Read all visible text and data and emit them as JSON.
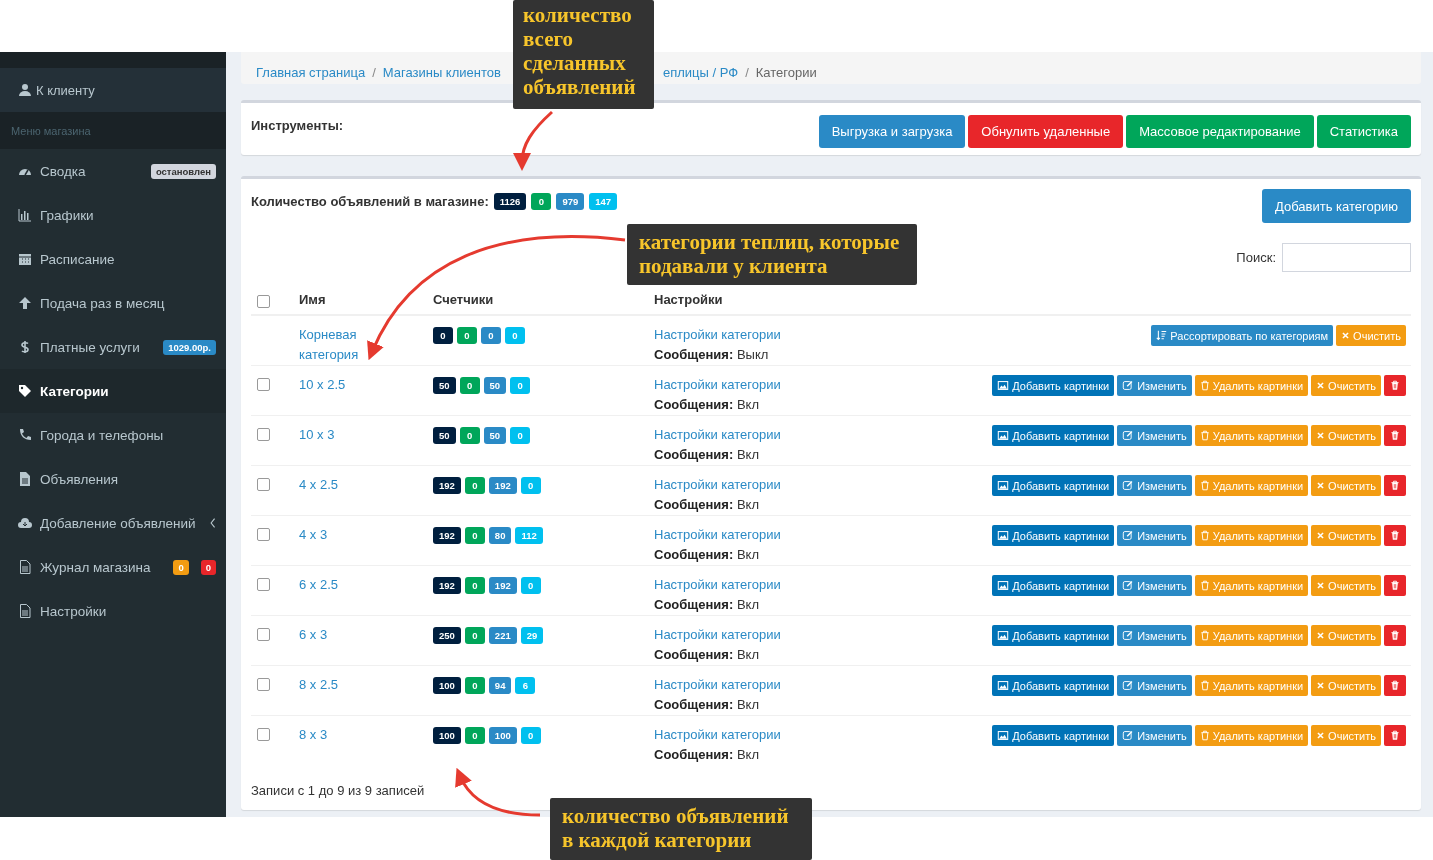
{
  "sidebar": {
    "client_link": "К клиенту",
    "section_title": "Меню магазина",
    "items": [
      {
        "label": "Сводка",
        "selected": false,
        "badges": [
          {
            "text": "остановлен",
            "color": "#d2d6de"
          }
        ]
      },
      {
        "label": "Графики",
        "selected": false
      },
      {
        "label": "Расписание",
        "selected": false
      },
      {
        "label": "Подача раз в месяц",
        "selected": false
      },
      {
        "label": "Платные услуги",
        "selected": false,
        "badges": [
          {
            "text": "1029.00р.",
            "color": "#2a8ac6"
          }
        ]
      },
      {
        "label": "Категории",
        "selected": true
      },
      {
        "label": "Города и телефоны",
        "selected": false
      },
      {
        "label": "Объявления",
        "selected": false
      },
      {
        "label": "Добавление объявлений",
        "selected": false,
        "expandable": true
      },
      {
        "label": "Журнал магазина",
        "selected": false,
        "badges": [
          {
            "text": "0",
            "color": "#f39c12"
          },
          {
            "text": "0",
            "color": "#e8262a"
          }
        ]
      },
      {
        "label": "Настройки",
        "selected": false
      }
    ]
  },
  "breadcrumb": {
    "separator": "/",
    "items": [
      "Главная страница",
      "Магазины клиентов",
      "еплицы / РФ",
      "Категории"
    ]
  },
  "tools": {
    "title": "Инструменты:",
    "buttons": [
      {
        "label": "Выгрузка и загрузка",
        "color": "#2a8ac6"
      },
      {
        "label": "Обнулить удаленные",
        "color": "#e8262a"
      },
      {
        "label": "Массовое редактирование",
        "color": "#00a65a"
      },
      {
        "label": "Статистика",
        "color": "#00a65a"
      }
    ]
  },
  "categories": {
    "count_label": "Количество объявлений в магазине:",
    "counts": [
      {
        "text": "1126",
        "color": "#001f3f"
      },
      {
        "text": "0",
        "color": "#00a65a"
      },
      {
        "text": "979",
        "color": "#2a8ac6"
      },
      {
        "text": "147",
        "color": "#00c0ef"
      }
    ],
    "add_button": "Добавить категорию",
    "search_label": "Поиск:",
    "table": {
      "select_all_checked": false,
      "columns": [
        "Имя",
        "Счетчики",
        "Настройки"
      ],
      "rows": [
        {
          "kind": "root",
          "name": "Корневая категория",
          "counters": [
            {
              "text": "0",
              "color": "#001f3f"
            },
            {
              "text": "0",
              "color": "#00a65a"
            },
            {
              "text": "0",
              "color": "#2a8ac6"
            },
            {
              "text": "0",
              "color": "#00c0ef"
            }
          ],
          "settings": "Настройки категории",
          "messages_label": "Сообщения:",
          "messages": "Выкл",
          "actions": [
            {
              "kind": "sort",
              "label": "Рассортировать по категориям"
            },
            {
              "kind": "clear",
              "label": "Очистить"
            }
          ]
        },
        {
          "kind": "category",
          "checked": false,
          "name": "10 x 2.5",
          "counters": [
            {
              "text": "50",
              "color": "#001f3f"
            },
            {
              "text": "0",
              "color": "#00a65a"
            },
            {
              "text": "50",
              "color": "#2a8ac6"
            },
            {
              "text": "0",
              "color": "#00c0ef"
            }
          ],
          "settings": "Настройки категории",
          "messages_label": "Сообщения:",
          "messages": "Вкл",
          "actions": [
            {
              "kind": "add-images",
              "label": "Добавить картинки"
            },
            {
              "kind": "edit",
              "label": "Изменить"
            },
            {
              "kind": "delete-images",
              "label": "Удалить картинки"
            },
            {
              "kind": "clear",
              "label": "Очистить"
            },
            {
              "kind": "delete"
            }
          ]
        },
        {
          "kind": "category",
          "checked": false,
          "name": "10 x 3",
          "counters": [
            {
              "text": "50",
              "color": "#001f3f"
            },
            {
              "text": "0",
              "color": "#00a65a"
            },
            {
              "text": "50",
              "color": "#2a8ac6"
            },
            {
              "text": "0",
              "color": "#00c0ef"
            }
          ],
          "settings": "Настройки категории",
          "messages_label": "Сообщения:",
          "messages": "Вкл",
          "actions": [
            {
              "kind": "add-images",
              "label": "Добавить картинки"
            },
            {
              "kind": "edit",
              "label": "Изменить"
            },
            {
              "kind": "delete-images",
              "label": "Удалить картинки"
            },
            {
              "kind": "clear",
              "label": "Очистить"
            },
            {
              "kind": "delete"
            }
          ]
        },
        {
          "kind": "category",
          "checked": false,
          "name": "4 x 2.5",
          "counters": [
            {
              "text": "192",
              "color": "#001f3f"
            },
            {
              "text": "0",
              "color": "#00a65a"
            },
            {
              "text": "192",
              "color": "#2a8ac6"
            },
            {
              "text": "0",
              "color": "#00c0ef"
            }
          ],
          "settings": "Настройки категории",
          "messages_label": "Сообщения:",
          "messages": "Вкл",
          "actions": [
            {
              "kind": "add-images",
              "label": "Добавить картинки"
            },
            {
              "kind": "edit",
              "label": "Изменить"
            },
            {
              "kind": "delete-images",
              "label": "Удалить картинки"
            },
            {
              "kind": "clear",
              "label": "Очистить"
            },
            {
              "kind": "delete"
            }
          ]
        },
        {
          "kind": "category",
          "checked": false,
          "name": "4 x 3",
          "counters": [
            {
              "text": "192",
              "color": "#001f3f"
            },
            {
              "text": "0",
              "color": "#00a65a"
            },
            {
              "text": "80",
              "color": "#2a8ac6"
            },
            {
              "text": "112",
              "color": "#00c0ef"
            }
          ],
          "settings": "Настройки категории",
          "messages_label": "Сообщения:",
          "messages": "Вкл",
          "actions": [
            {
              "kind": "add-images",
              "label": "Добавить картинки"
            },
            {
              "kind": "edit",
              "label": "Изменить"
            },
            {
              "kind": "delete-images",
              "label": "Удалить картинки"
            },
            {
              "kind": "clear",
              "label": "Очистить"
            },
            {
              "kind": "delete"
            }
          ]
        },
        {
          "kind": "category",
          "checked": false,
          "name": "6 x 2.5",
          "counters": [
            {
              "text": "192",
              "color": "#001f3f"
            },
            {
              "text": "0",
              "color": "#00a65a"
            },
            {
              "text": "192",
              "color": "#2a8ac6"
            },
            {
              "text": "0",
              "color": "#00c0ef"
            }
          ],
          "settings": "Настройки категории",
          "messages_label": "Сообщения:",
          "messages": "Вкл",
          "actions": [
            {
              "kind": "add-images",
              "label": "Добавить картинки"
            },
            {
              "kind": "edit",
              "label": "Изменить"
            },
            {
              "kind": "delete-images",
              "label": "Удалить картинки"
            },
            {
              "kind": "clear",
              "label": "Очистить"
            },
            {
              "kind": "delete"
            }
          ]
        },
        {
          "kind": "category",
          "checked": false,
          "name": "6 x 3",
          "counters": [
            {
              "text": "250",
              "color": "#001f3f"
            },
            {
              "text": "0",
              "color": "#00a65a"
            },
            {
              "text": "221",
              "color": "#2a8ac6"
            },
            {
              "text": "29",
              "color": "#00c0ef"
            }
          ],
          "settings": "Настройки категории",
          "messages_label": "Сообщения:",
          "messages": "Вкл",
          "actions": [
            {
              "kind": "add-images",
              "label": "Добавить картинки"
            },
            {
              "kind": "edit",
              "label": "Изменить"
            },
            {
              "kind": "delete-images",
              "label": "Удалить картинки"
            },
            {
              "kind": "clear",
              "label": "Очистить"
            },
            {
              "kind": "delete"
            }
          ]
        },
        {
          "kind": "category",
          "checked": false,
          "name": "8 x 2.5",
          "counters": [
            {
              "text": "100",
              "color": "#001f3f"
            },
            {
              "text": "0",
              "color": "#00a65a"
            },
            {
              "text": "94",
              "color": "#2a8ac6"
            },
            {
              "text": "6",
              "color": "#00c0ef"
            }
          ],
          "settings": "Настройки категории",
          "messages_label": "Сообщения:",
          "messages": "Вкл",
          "actions": [
            {
              "kind": "add-images",
              "label": "Добавить картинки"
            },
            {
              "kind": "edit",
              "label": "Изменить"
            },
            {
              "kind": "delete-images",
              "label": "Удалить картинки"
            },
            {
              "kind": "clear",
              "label": "Очистить"
            },
            {
              "kind": "delete"
            }
          ]
        },
        {
          "kind": "category",
          "checked": false,
          "name": "8 x 3",
          "counters": [
            {
              "text": "100",
              "color": "#001f3f"
            },
            {
              "text": "0",
              "color": "#00a65a"
            },
            {
              "text": "100",
              "color": "#2a8ac6"
            },
            {
              "text": "0",
              "color": "#00c0ef"
            }
          ],
          "settings": "Настройки категории",
          "messages_label": "Сообщения:",
          "messages": "Вкл",
          "actions": [
            {
              "kind": "add-images",
              "label": "Добавить картинки"
            },
            {
              "kind": "edit",
              "label": "Изменить"
            },
            {
              "kind": "delete-images",
              "label": "Удалить картинки"
            },
            {
              "kind": "clear",
              "label": "Очистить"
            },
            {
              "kind": "delete"
            }
          ]
        }
      ]
    },
    "footer": "Записи с 1 до 9 из 9 записей"
  },
  "annotations": [
    "количество всего сделанных объявлений",
    "категории теплиц, которые подавали у клиента",
    "количество объявлений в каждой категории"
  ]
}
